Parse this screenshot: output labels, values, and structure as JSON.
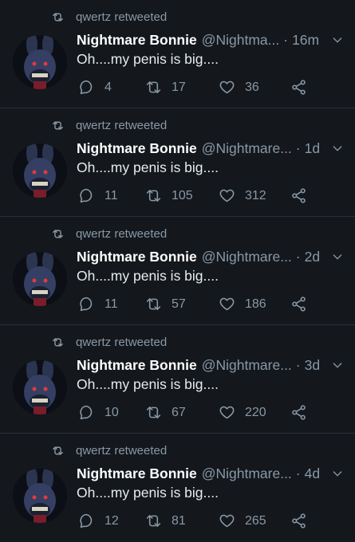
{
  "retweet_label": "qwertz retweeted",
  "colors": {
    "background": "#14171c",
    "muted": "#8899a6",
    "text": "#e6ecf0",
    "divider": "#2a2f36"
  },
  "tweets": [
    {
      "name": "Nightmare Bonnie",
      "handle": "@Nightma...",
      "time": "16m",
      "text": "Oh....my penis is big....",
      "replies": "4",
      "retweets": "17",
      "likes": "36"
    },
    {
      "name": "Nightmare Bonnie",
      "handle": "@Nightmare...",
      "time": "1d",
      "text": "Oh....my penis is big....",
      "replies": "11",
      "retweets": "105",
      "likes": "312"
    },
    {
      "name": "Nightmare Bonnie",
      "handle": "@Nightmare...",
      "time": "2d",
      "text": "Oh....my penis is big....",
      "replies": "11",
      "retweets": "57",
      "likes": "186"
    },
    {
      "name": "Nightmare Bonnie",
      "handle": "@Nightmare...",
      "time": "3d",
      "text": "Oh....my penis is big....",
      "replies": "10",
      "retweets": "67",
      "likes": "220"
    },
    {
      "name": "Nightmare Bonnie",
      "handle": "@Nightmare...",
      "time": "4d",
      "text": "Oh....my penis is big....",
      "replies": "12",
      "retweets": "81",
      "likes": "265"
    }
  ]
}
